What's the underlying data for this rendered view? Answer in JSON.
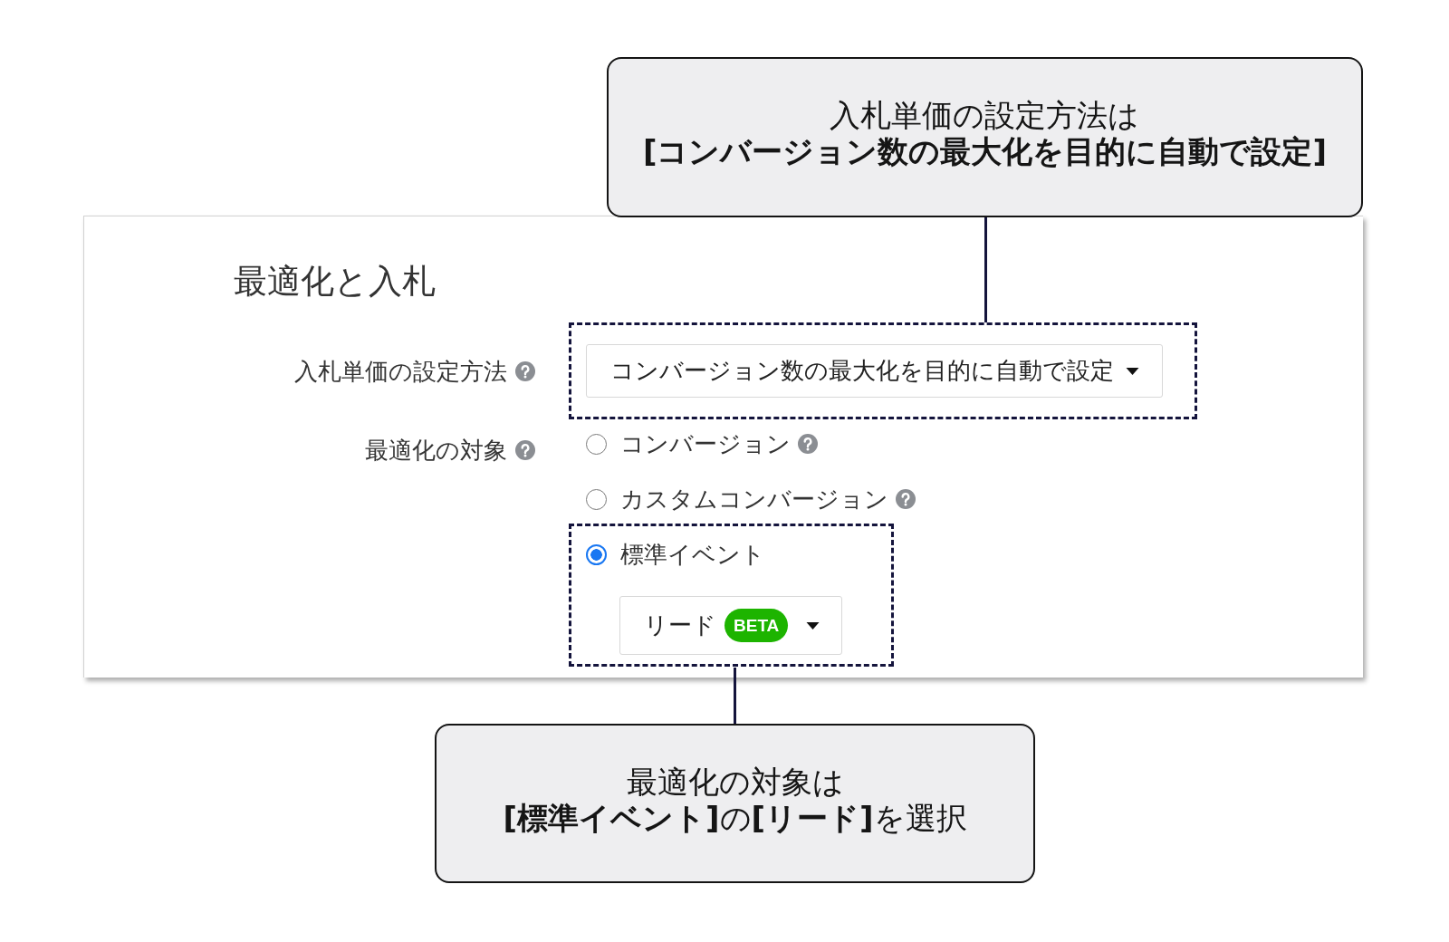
{
  "top_callout": {
    "text": "入札単価の設定方法は\n**[コンバージョン数の最大化を目的に自動で設定]**"
  },
  "panel": {
    "title": "最適化と入札",
    "fields": [
      {
        "kind": "dropdown",
        "label": "入札単価の設定方法",
        "help": true,
        "value": "コンバージョン数の最大化を目的に自動で設定",
        "highlighted": true
      },
      {
        "kind": "radio_group",
        "label": "最適化の対象",
        "help": true,
        "options": [
          {
            "label": "コンバージョン",
            "selected": false,
            "help": true,
            "highlighted": false
          },
          {
            "label": "カスタムコンバージョン",
            "selected": false,
            "help": true,
            "highlighted": false
          },
          {
            "label": "標準イベント",
            "selected": true,
            "help": false,
            "highlighted": true,
            "dropdown": {
              "value": "リード",
              "badge": "BETA"
            }
          }
        ]
      }
    ]
  },
  "bottom_callout": {
    "text": "最適化の対象は\n**[標準イベント]**の**[リード]**を選択"
  }
}
